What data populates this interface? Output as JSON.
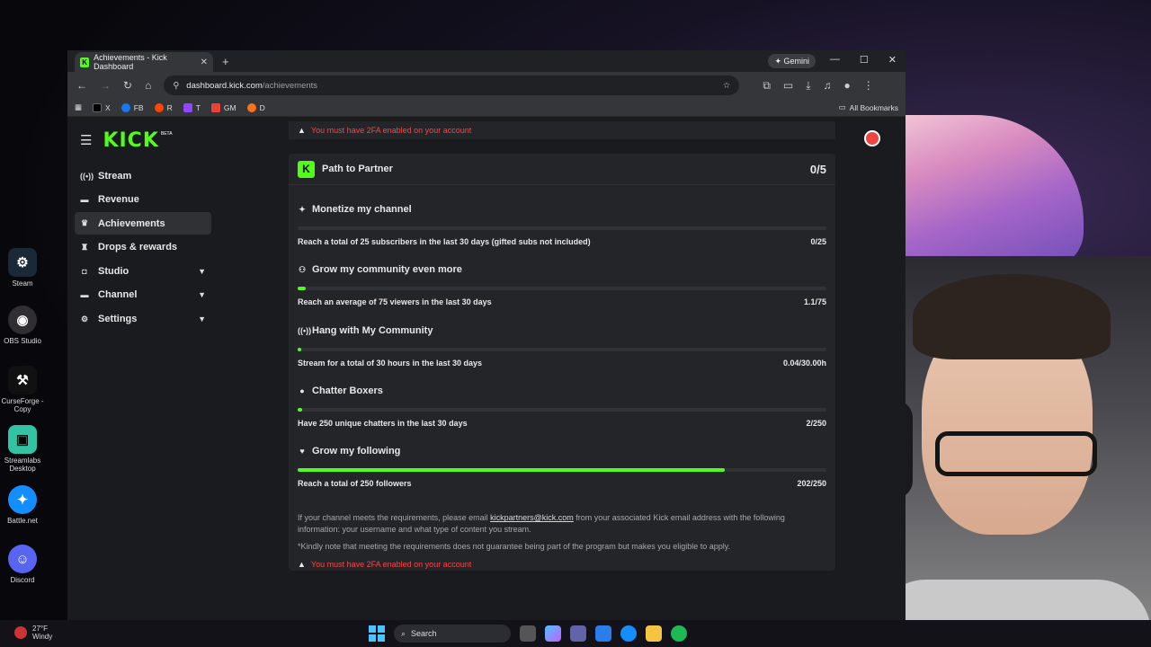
{
  "browser": {
    "tab_title": "Achievements - Kick Dashboard",
    "gemini_label": "Gemini",
    "url_host": "dashboard.kick.com",
    "url_path": "/achievements",
    "bookmarks": [
      {
        "label": "X",
        "color": "#000000"
      },
      {
        "label": "FB",
        "color": "#1877f2"
      },
      {
        "label": "R",
        "color": "#ff4500"
      },
      {
        "label": "T",
        "color": "#9146ff"
      },
      {
        "label": "GM",
        "color": "#ea4335"
      },
      {
        "label": "D",
        "color": "#f97316"
      }
    ],
    "all_bookmarks": "All Bookmarks"
  },
  "kick": {
    "logo": "KICK",
    "beta": "BETA",
    "accent": "#53fc18",
    "nav": [
      {
        "label": "Stream",
        "icon": "stream-icon"
      },
      {
        "label": "Revenue",
        "icon": "revenue-icon"
      },
      {
        "label": "Achievements",
        "icon": "trophy-icon"
      },
      {
        "label": "Drops & rewards",
        "icon": "gift-icon"
      },
      {
        "label": "Studio",
        "icon": "studio-icon"
      },
      {
        "label": "Channel",
        "icon": "channel-icon"
      },
      {
        "label": "Settings",
        "icon": "gear-icon"
      }
    ],
    "active_nav": "Achievements"
  },
  "partner": {
    "warning": "You must have 2FA enabled on your account",
    "title": "Path to Partner",
    "count": "0/5",
    "achievements": [
      {
        "title": "Monetize my channel",
        "icon": "sparkle-icon",
        "desc": "Reach a total of 25 subscribers in the last 30 days (gifted subs not included)",
        "value": "0/25",
        "progress": 0
      },
      {
        "title": "Grow my community even more",
        "icon": "users-icon",
        "desc": "Reach an average of 75 viewers in the last 30 days",
        "value": "1.1/75",
        "progress": 0.015
      },
      {
        "title": "Hang with My Community",
        "icon": "broadcast-icon",
        "desc": "Stream for a total of 30 hours in the last 30 days",
        "value": "0.04/30.00h",
        "progress": 0.0013
      },
      {
        "title": "Chatter Boxers",
        "icon": "chat-icon",
        "desc": "Have 250 unique chatters in the last 30 days",
        "value": "2/250",
        "progress": 0.008
      },
      {
        "title": "Grow my following",
        "icon": "heart-icon",
        "desc": "Reach a total of 250 followers",
        "value": "202/250",
        "progress": 0.808
      }
    ],
    "footer_pre": "If your channel meets the requirements, please email ",
    "footer_email": "kickpartners@kick.com",
    "footer_post": " from your associated Kick email address with the following information: your username and what type of content you stream.",
    "footer_note": "*Kindly note that meeting the requirements does not guarantee being part of the program but makes you eligible to apply."
  },
  "desktop": {
    "icons": [
      "Steam",
      "OBS Studio",
      "CurseForge - Copy",
      "Streamlabs Desktop",
      "Battle.net",
      "Discord"
    ]
  },
  "taskbar": {
    "temp": "27°F",
    "weather": "Windy",
    "search": "Search"
  }
}
